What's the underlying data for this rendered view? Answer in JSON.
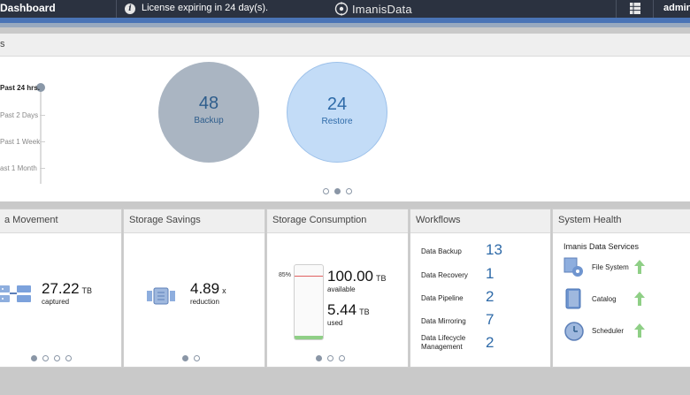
{
  "topbar": {
    "title": "Dashboard",
    "license": "License expiring in 24 day(s).",
    "logo_text": "ImanisData",
    "user": "admin"
  },
  "activity": {
    "header": "s",
    "ranges": [
      "Past 24 hrs.",
      "Past 2 Days",
      "Past 1 Week",
      "ast 1 Month"
    ],
    "selected_range": "Past 24 hrs.",
    "backup": {
      "count": "48",
      "label": "Backup"
    },
    "restore": {
      "count": "24",
      "label": "Restore"
    }
  },
  "data_movement": {
    "title": "a Movement",
    "value": "27.22",
    "unit": "TB",
    "caption": "captured"
  },
  "storage_savings": {
    "title": "Storage Savings",
    "value": "4.89",
    "unit": "x",
    "caption": "reduction"
  },
  "storage_consumption": {
    "title": "Storage Consumption",
    "percent_label": "85%",
    "available_value": "100.00",
    "available_unit": "TB",
    "available_caption": "available",
    "used_value": "5.44",
    "used_unit": "TB",
    "used_caption": "used"
  },
  "workflows": {
    "title": "Workflows",
    "items": [
      {
        "label": "Data Backup",
        "value": "13"
      },
      {
        "label": "Data Recovery",
        "value": "1"
      },
      {
        "label": "Data Pipeline",
        "value": "2"
      },
      {
        "label": "Data Mirroring",
        "value": "7"
      },
      {
        "label": "Data Lifecycle Management",
        "value": "2"
      }
    ]
  },
  "system_health": {
    "title": "System Health",
    "subtitle": "Imanis Data Services",
    "services": [
      {
        "label": "File System",
        "icon": "gear-folder-icon",
        "status": "up"
      },
      {
        "label": "Catalog",
        "icon": "book-icon",
        "status": "up"
      },
      {
        "label": "Scheduler",
        "icon": "clock-icon",
        "status": "up"
      }
    ]
  },
  "colors": {
    "topbar": "#2b3240",
    "accent": "#4a74b6",
    "value_blue": "#2e6aa8",
    "status_up": "#8fcf86"
  }
}
